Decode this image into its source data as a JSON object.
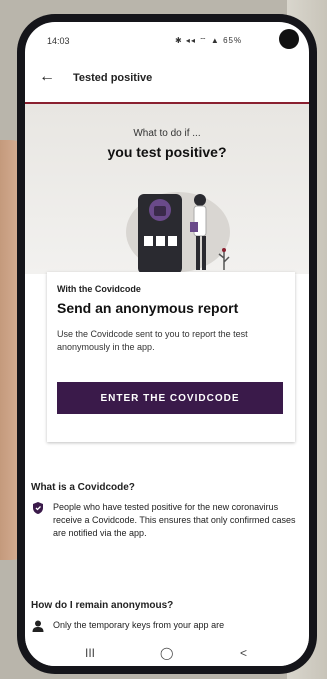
{
  "status": {
    "time": "14:03",
    "icons": "✱ ◂◂ ⌔ ▲ 65%"
  },
  "appbar": {
    "title": "Tested positive"
  },
  "hero": {
    "subtitle": "What to do if ...",
    "title": "you test positive?"
  },
  "card": {
    "small": "With the Covidcode",
    "title": "Send an anonymous report",
    "text": "Use the Covidcode sent to you to report the test anonymously in the app.",
    "button_label": "ENTER THE COVIDCODE"
  },
  "sections": [
    {
      "title": "What is a Covidcode?",
      "items": [
        {
          "icon": "shield-icon",
          "text": "People who have tested positive for the new coronavirus receive a Covidcode. This ensures that only confirmed cases are notified via the app."
        }
      ]
    },
    {
      "title": "How do I remain anonymous?",
      "items": [
        {
          "icon": "user-icon",
          "text": "Only the temporary keys from your app are"
        }
      ]
    }
  ],
  "nav": {
    "recent": "III",
    "home": "◯",
    "back": "<"
  },
  "colors": {
    "accent": "#8a2030",
    "button": "#3a1a4a"
  }
}
